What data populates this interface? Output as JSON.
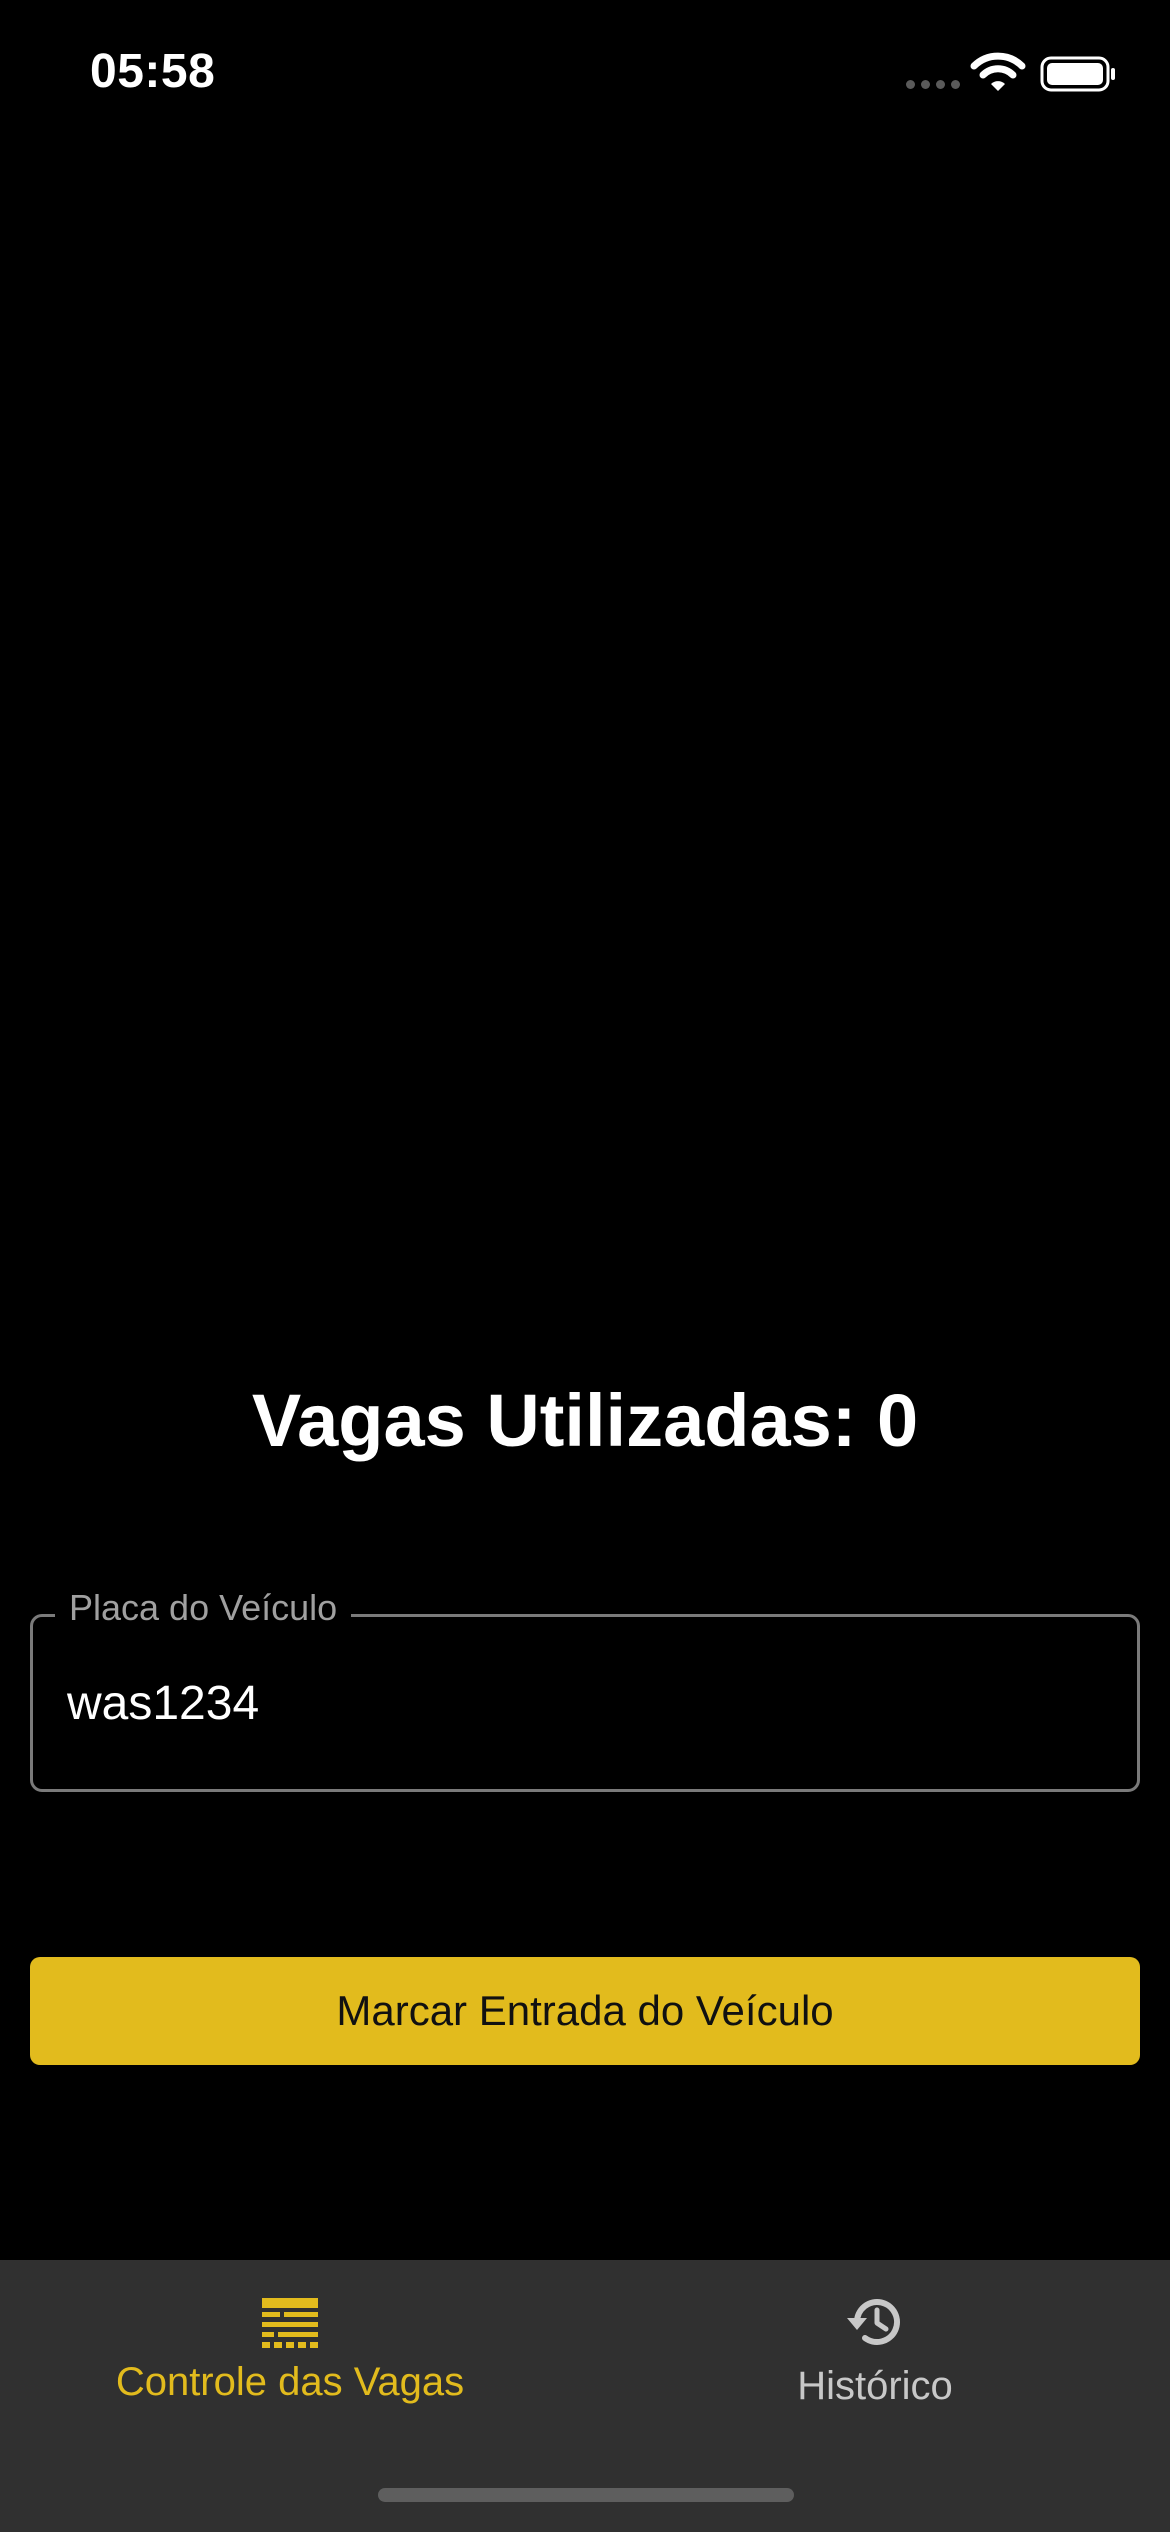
{
  "status_bar": {
    "time": "05:58",
    "icons": [
      "signal-dots-icon",
      "wifi-icon",
      "battery-icon"
    ]
  },
  "main": {
    "title": "Vagas Utilizadas: 0",
    "plate_field": {
      "label": "Placa do Veículo",
      "value": "was1234"
    },
    "entry_button_label": "Marcar Entrada do Veículo"
  },
  "tab_bar": {
    "tabs": [
      {
        "label": "Controle das Vagas",
        "icon": "parking-spots-icon",
        "active": true
      },
      {
        "label": "Histórico",
        "icon": "history-icon",
        "active": false
      }
    ]
  },
  "colors": {
    "accent": "#e2bb1d",
    "background": "#000000",
    "tab_bar_background": "#303030",
    "inactive_tab": "#c8c8c8"
  }
}
